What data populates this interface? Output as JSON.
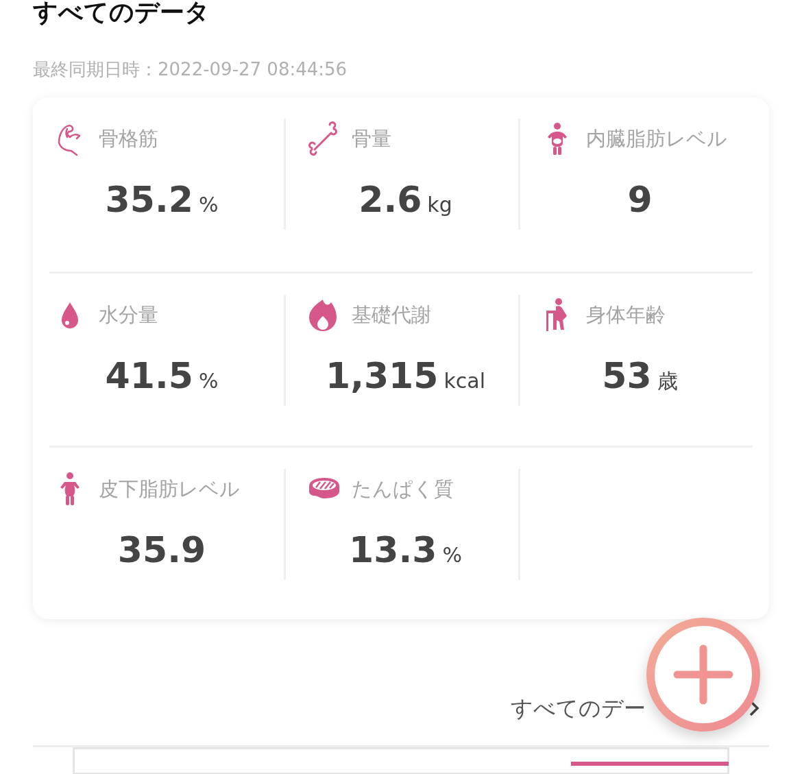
{
  "title": "すべてのデータ",
  "last_sync": "最終同期日時：2022-09-27 08:44:56",
  "metrics": [
    {
      "label": "骨格筋",
      "value": "35.2",
      "unit": "%"
    },
    {
      "label": "骨量",
      "value": "2.6",
      "unit": "kg"
    },
    {
      "label": "内臓脂肪レベル",
      "value": "9"
    },
    {
      "label": "水分量",
      "value": "41.5",
      "unit": "%"
    },
    {
      "label": "基礎代謝",
      "value": "1,315",
      "unit": "kcal"
    },
    {
      "label": "身体年齢",
      "value": "53",
      "unit": "歳"
    },
    {
      "label": "皮下脂肪レベル",
      "value": "35.9"
    },
    {
      "label": "たんぱく質",
      "value": "13.3",
      "unit": "%"
    }
  ],
  "all_data_link": "すべてのデー"
}
